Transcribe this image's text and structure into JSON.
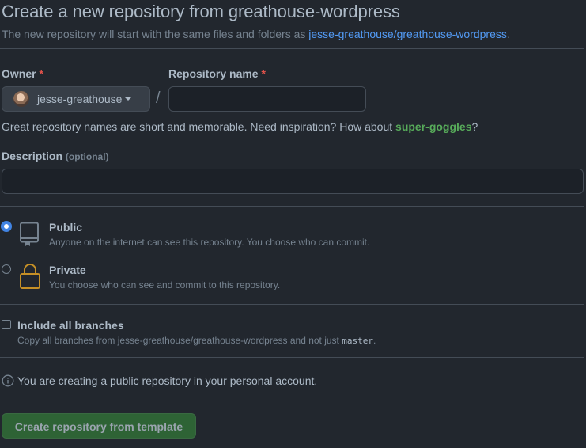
{
  "header": {
    "title": "Create a new repository from greathouse-wordpress",
    "subtitle_prefix": "The new repository will start with the same files and folders as ",
    "template_link": "jesse-greathouse/greathouse-wordpress",
    "subtitle_suffix": "."
  },
  "owner": {
    "label": "Owner",
    "required_mark": "*",
    "selected": "jesse-greathouse"
  },
  "separator": "/",
  "repo_name": {
    "label": "Repository name",
    "required_mark": "*",
    "value": "",
    "placeholder": ""
  },
  "hint": {
    "prefix": "Great repository names are short and memorable. Need inspiration? How about ",
    "suggestion": "super-goggles",
    "suffix": "?"
  },
  "description": {
    "label": "Description",
    "optional": "(optional)",
    "value": "",
    "placeholder": ""
  },
  "visibility": {
    "public": {
      "title": "Public",
      "desc": "Anyone on the internet can see this repository. You choose who can commit.",
      "checked": true
    },
    "private": {
      "title": "Private",
      "desc": "You choose who can see and commit to this repository.",
      "checked": false
    }
  },
  "branches": {
    "title": "Include all branches",
    "desc_prefix": "Copy all branches from jesse-greathouse/greathouse-wordpress and not just ",
    "desc_code": "master",
    "desc_suffix": ".",
    "checked": false
  },
  "info": {
    "text": "You are creating a public repository in your personal account."
  },
  "submit": {
    "label": "Create repository from template"
  },
  "colors": {
    "background": "#22272e",
    "link": "#539bf5",
    "suggestion": "#57ab5a",
    "required": "#e5534b",
    "radio_checked": "#4184e4",
    "button_green": "#347d39",
    "lock_icon": "#c69026"
  },
  "icons": {
    "public": "repo-icon",
    "private": "lock-icon",
    "info": "info-icon",
    "dropdown": "caret-down-icon"
  }
}
